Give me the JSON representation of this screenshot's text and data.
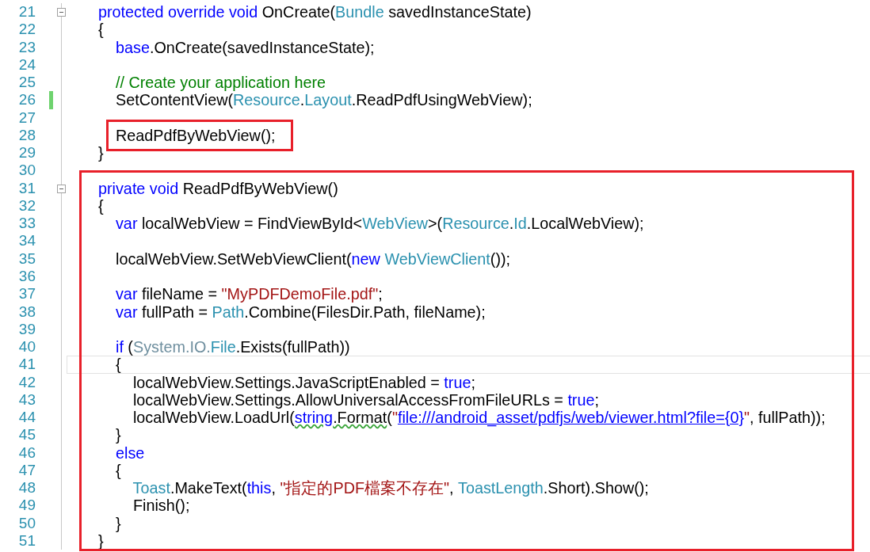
{
  "segments": [
    {
      "kind": "plain",
      "lines": [
        {
          "number": "21",
          "fold": true,
          "changed": false,
          "current": false,
          "boxed": false,
          "tokens": [
            {
              "kind": "keyword",
              "text": "protected override void"
            },
            {
              "kind": "plain",
              "text": " OnCreate("
            },
            {
              "kind": "type",
              "text": "Bundle"
            },
            {
              "kind": "plain",
              "text": " savedInstanceState)"
            }
          ]
        },
        {
          "number": "22",
          "fold": false,
          "changed": false,
          "current": false,
          "boxed": false,
          "tokens": [
            {
              "kind": "plain",
              "text": "{"
            }
          ]
        },
        {
          "number": "23",
          "fold": false,
          "changed": false,
          "current": false,
          "boxed": false,
          "tokens": [
            {
              "kind": "keyword",
              "text": "    base"
            },
            {
              "kind": "plain",
              "text": ".OnCreate(savedInstanceState);"
            }
          ]
        },
        {
          "number": "24",
          "fold": false,
          "changed": false,
          "current": false,
          "boxed": false
        },
        {
          "number": "25",
          "fold": false,
          "changed": false,
          "current": false,
          "boxed": false,
          "tokens": [
            {
              "kind": "comment",
              "text": "    // Create your application here"
            }
          ]
        },
        {
          "number": "26",
          "fold": false,
          "changed": true,
          "current": false,
          "boxed": false,
          "tokens": [
            {
              "kind": "plain",
              "text": "    SetContentView("
            },
            {
              "kind": "type",
              "text": "Resource"
            },
            {
              "kind": "plain",
              "text": "."
            },
            {
              "kind": "type",
              "text": "Layout"
            },
            {
              "kind": "plain",
              "text": ".ReadPdfUsingWebView);"
            }
          ]
        },
        {
          "number": "27",
          "fold": false,
          "changed": false,
          "current": false,
          "boxed": false
        },
        {
          "number": "28",
          "fold": false,
          "changed": false,
          "current": false,
          "boxed": true,
          "tokens": [
            {
              "kind": "plain",
              "text": "    ReadPdfByWebView();"
            }
          ]
        },
        {
          "number": "29",
          "fold": false,
          "changed": false,
          "current": false,
          "boxed": false,
          "tokens": [
            {
              "kind": "plain",
              "text": "}"
            }
          ]
        },
        {
          "number": "30",
          "fold": false,
          "changed": false,
          "current": false,
          "boxed": false
        }
      ]
    },
    {
      "kind": "boxed",
      "lines": [
        {
          "number": "31",
          "fold": true,
          "changed": false,
          "current": false,
          "boxed": false,
          "tokens": [
            {
              "kind": "keyword",
              "text": "private void"
            },
            {
              "kind": "plain",
              "text": " ReadPdfByWebView()"
            }
          ]
        },
        {
          "number": "32",
          "fold": false,
          "changed": false,
          "current": false,
          "boxed": false,
          "tokens": [
            {
              "kind": "plain",
              "text": "{"
            }
          ]
        },
        {
          "number": "33",
          "fold": false,
          "changed": false,
          "current": false,
          "boxed": false,
          "tokens": [
            {
              "kind": "keyword",
              "text": "    var"
            },
            {
              "kind": "plain",
              "text": " localWebView = FindViewById<"
            },
            {
              "kind": "type",
              "text": "WebView"
            },
            {
              "kind": "plain",
              "text": ">("
            },
            {
              "kind": "type",
              "text": "Resource"
            },
            {
              "kind": "plain",
              "text": "."
            },
            {
              "kind": "type",
              "text": "Id"
            },
            {
              "kind": "plain",
              "text": ".LocalWebView);"
            }
          ]
        },
        {
          "number": "34",
          "fold": false,
          "changed": false,
          "current": false,
          "boxed": false
        },
        {
          "number": "35",
          "fold": false,
          "changed": false,
          "current": false,
          "boxed": false,
          "tokens": [
            {
              "kind": "plain",
              "text": "    localWebView.SetWebViewClient("
            },
            {
              "kind": "keyword",
              "text": "new"
            },
            {
              "kind": "type",
              "text": " WebViewClient"
            },
            {
              "kind": "plain",
              "text": "());"
            }
          ]
        },
        {
          "number": "36",
          "fold": false,
          "changed": false,
          "current": false,
          "boxed": false
        },
        {
          "number": "37",
          "fold": false,
          "changed": false,
          "current": false,
          "boxed": false,
          "tokens": [
            {
              "kind": "keyword",
              "text": "    var"
            },
            {
              "kind": "plain",
              "text": " fileName = "
            },
            {
              "kind": "string",
              "text": "\"MyPDFDemoFile.pdf\""
            },
            {
              "kind": "plain",
              "text": ";"
            }
          ]
        },
        {
          "number": "38",
          "fold": false,
          "changed": false,
          "current": false,
          "boxed": false,
          "tokens": [
            {
              "kind": "keyword",
              "text": "    var"
            },
            {
              "kind": "plain",
              "text": " fullPath = "
            },
            {
              "kind": "type",
              "text": "Path"
            },
            {
              "kind": "plain",
              "text": ".Combine(FilesDir.Path, fileName);"
            }
          ]
        },
        {
          "number": "39",
          "fold": false,
          "changed": false,
          "current": false,
          "boxed": false
        },
        {
          "number": "40",
          "fold": false,
          "changed": false,
          "current": false,
          "boxed": false,
          "tokens": [
            {
              "kind": "keyword",
              "text": "    if"
            },
            {
              "kind": "plain",
              "text": " ("
            },
            {
              "kind": "namespace",
              "text": "System.IO."
            },
            {
              "kind": "type",
              "text": "File"
            },
            {
              "kind": "plain",
              "text": ".Exists(fullPath))"
            }
          ]
        },
        {
          "number": "41",
          "fold": false,
          "changed": false,
          "current": true,
          "boxed": false,
          "tokens": [
            {
              "kind": "plain",
              "text": "    {"
            }
          ]
        },
        {
          "number": "42",
          "fold": false,
          "changed": false,
          "current": false,
          "boxed": false,
          "tokens": [
            {
              "kind": "plain",
              "text": "        localWebView.Settings.JavaScriptEnabled = "
            },
            {
              "kind": "keyword",
              "text": "true"
            },
            {
              "kind": "plain",
              "text": ";"
            }
          ]
        },
        {
          "number": "43",
          "fold": false,
          "changed": false,
          "current": false,
          "boxed": false,
          "tokens": [
            {
              "kind": "plain",
              "text": "        localWebView.Settings.AllowUniversalAccessFromFileURLs = "
            },
            {
              "kind": "keyword",
              "text": "true"
            },
            {
              "kind": "plain",
              "text": ";"
            }
          ]
        },
        {
          "number": "44",
          "fold": false,
          "changed": false,
          "current": false,
          "boxed": false,
          "tokens": [
            {
              "kind": "plain",
              "text": "        localWebView.LoadUrl("
            },
            {
              "kind": "keyword_warn",
              "text": "string"
            },
            {
              "kind": "plain_warn",
              "text": ".Format"
            },
            {
              "kind": "plain",
              "text": "("
            },
            {
              "kind": "string",
              "text": "\""
            },
            {
              "kind": "url",
              "text": "file:///android_asset/pdfjs/web/viewer.html?file={0}"
            },
            {
              "kind": "string",
              "text": "\""
            },
            {
              "kind": "plain",
              "text": ", fullPath));"
            }
          ]
        },
        {
          "number": "45",
          "fold": false,
          "changed": false,
          "current": false,
          "boxed": false,
          "tokens": [
            {
              "kind": "plain",
              "text": "    }"
            }
          ]
        },
        {
          "number": "46",
          "fold": false,
          "changed": false,
          "current": false,
          "boxed": false,
          "tokens": [
            {
              "kind": "keyword",
              "text": "    else"
            }
          ]
        },
        {
          "number": "47",
          "fold": false,
          "changed": false,
          "current": false,
          "boxed": false,
          "tokens": [
            {
              "kind": "plain",
              "text": "    {"
            }
          ]
        },
        {
          "number": "48",
          "fold": false,
          "changed": false,
          "current": false,
          "boxed": false,
          "tokens": [
            {
              "kind": "type",
              "text": "        Toast"
            },
            {
              "kind": "plain",
              "text": ".MakeText("
            },
            {
              "kind": "keyword",
              "text": "this"
            },
            {
              "kind": "plain",
              "text": ", "
            },
            {
              "kind": "string",
              "text": "\"指定的PDF檔案不存在\""
            },
            {
              "kind": "plain",
              "text": ", "
            },
            {
              "kind": "type",
              "text": "ToastLength"
            },
            {
              "kind": "plain",
              "text": ".Short).Show();"
            }
          ]
        },
        {
          "number": "49",
          "fold": false,
          "changed": false,
          "current": false,
          "boxed": false,
          "tokens": [
            {
              "kind": "plain",
              "text": "        Finish();"
            }
          ]
        },
        {
          "number": "50",
          "fold": false,
          "changed": false,
          "current": false,
          "boxed": false,
          "tokens": [
            {
              "kind": "plain",
              "text": "    }"
            }
          ]
        },
        {
          "number": "51",
          "fold": false,
          "changed": false,
          "current": false,
          "boxed": false,
          "tokens": [
            {
              "kind": "plain",
              "text": "}"
            }
          ]
        }
      ]
    }
  ]
}
